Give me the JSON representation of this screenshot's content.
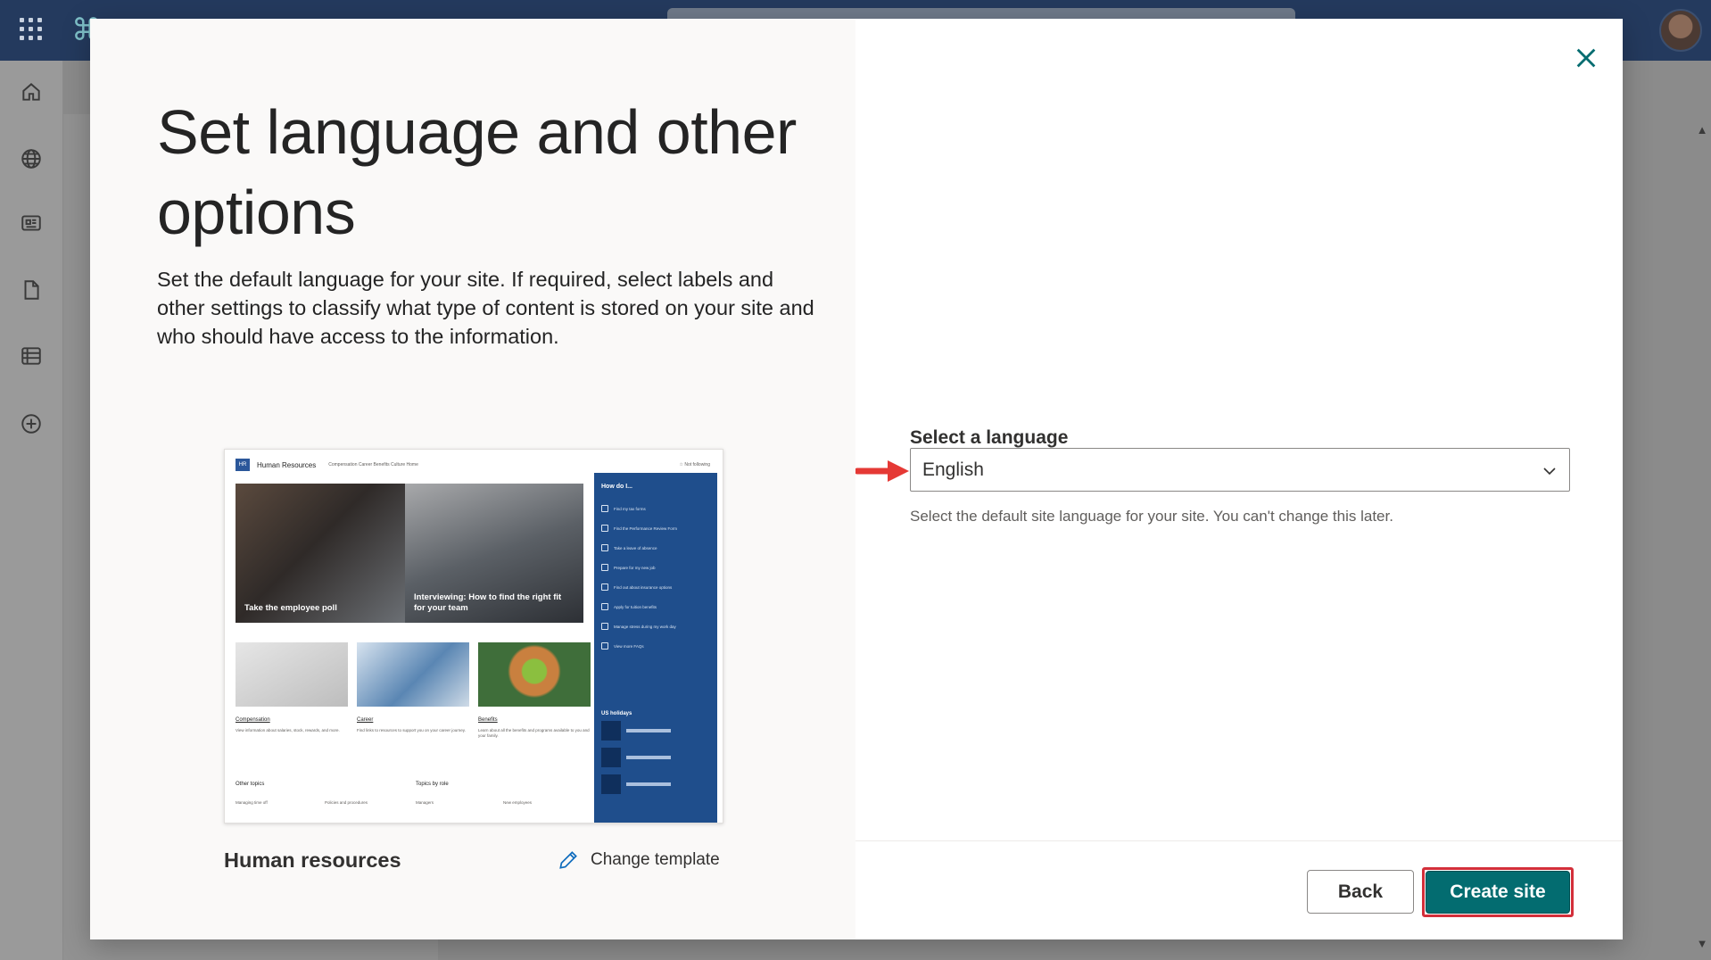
{
  "dialog": {
    "title": "Set language and other options",
    "description": "Set the default language for your site. If required, select labels and other settings to classify what type of content is stored on your site and who should have access to the information.",
    "close_icon": "close-icon"
  },
  "template": {
    "name": "Human resources",
    "change_label": "Change template",
    "change_icon": "pencil-icon",
    "preview": {
      "logo": "HR",
      "site_name": "Human Resources",
      "nav": "Compensation   Career   Benefits   Culture   Home",
      "follow": "☆ Not following",
      "hero_left_caption": "Take the employee poll",
      "hero_right_caption": "Interviewing: How to find the right fit for your team",
      "side_title": "How do I...",
      "side_items": [
        "Find my tax forms",
        "Find the Performance Review Form",
        "Take a leave of absence",
        "Prepare for my new job",
        "Find out about insurance options",
        "Apply for tuition benefits",
        "Manage stress during my work day",
        "View more FAQs"
      ],
      "side_holidays": "US holidays",
      "cards": [
        {
          "label": "Compensation",
          "text": "View information about salaries, stock, rewards, and more."
        },
        {
          "label": "Career",
          "text": "Find links to resources to support you on your career journey."
        },
        {
          "label": "Benefits",
          "text": "Learn about all the benefits and programs available to you and your family."
        }
      ],
      "other_topics": "Other topics",
      "topics_by_role": "Topics by role",
      "rows": [
        "Managing time off",
        "Policies and procedures",
        "Managers",
        "New employees"
      ]
    }
  },
  "language": {
    "label": "Select a language",
    "selected": "English",
    "help": "Select the default site language for your site. You can't change this later."
  },
  "footer": {
    "back_label": "Back",
    "create_label": "Create site"
  },
  "colors": {
    "accent": "#036c70",
    "suitebar": "#243a5e",
    "highlight": "#d32f3a"
  },
  "rail_icons": [
    "home-icon",
    "globe-icon",
    "news-icon",
    "document-icon",
    "list-icon",
    "add-circle-icon"
  ]
}
